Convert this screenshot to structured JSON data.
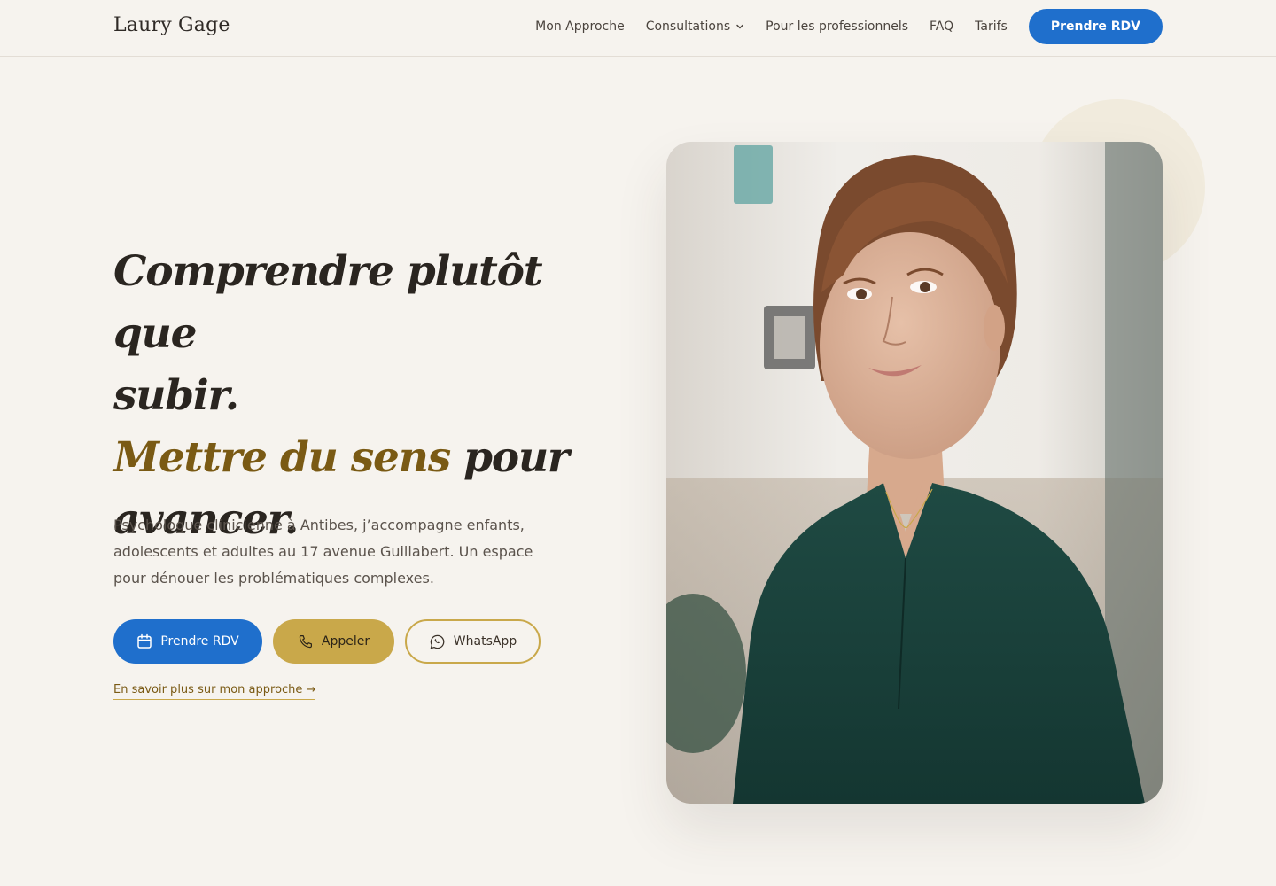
{
  "header": {
    "logo": "Laury Gage",
    "nav": [
      {
        "label": "Mon Approche"
      },
      {
        "label": "Consultations",
        "has_dropdown": true
      },
      {
        "label": "Pour les professionnels"
      },
      {
        "label": "FAQ"
      },
      {
        "label": "Tarifs"
      }
    ],
    "cta_label": "Prendre RDV"
  },
  "hero": {
    "title_line1": "Comprendre plutôt que",
    "title_line2": "subir.",
    "title_accent": "Mettre du sens",
    "title_line3_rest": " pour",
    "title_line4": "avancer.",
    "description": "Psychologue clinicienne à Antibes, j’accompagne enfants, adolescents et adultes au 17 avenue Guillabert. Un espace pour dénouer les problématiques complexes.",
    "buttons": {
      "rdv": {
        "label": "Prendre RDV",
        "icon": "calendar-icon"
      },
      "call": {
        "label": "Appeler",
        "icon": "phone-icon"
      },
      "whatsapp": {
        "label": "WhatsApp",
        "icon": "whatsapp-icon"
      }
    },
    "more_link": "En savoir plus sur mon approche →"
  },
  "colors": {
    "background": "#f6f3ee",
    "primary_blue": "#1f6fcc",
    "gold": "#c9a84a",
    "accent_text": "#7a5a14",
    "text_dark": "#2a2520"
  }
}
